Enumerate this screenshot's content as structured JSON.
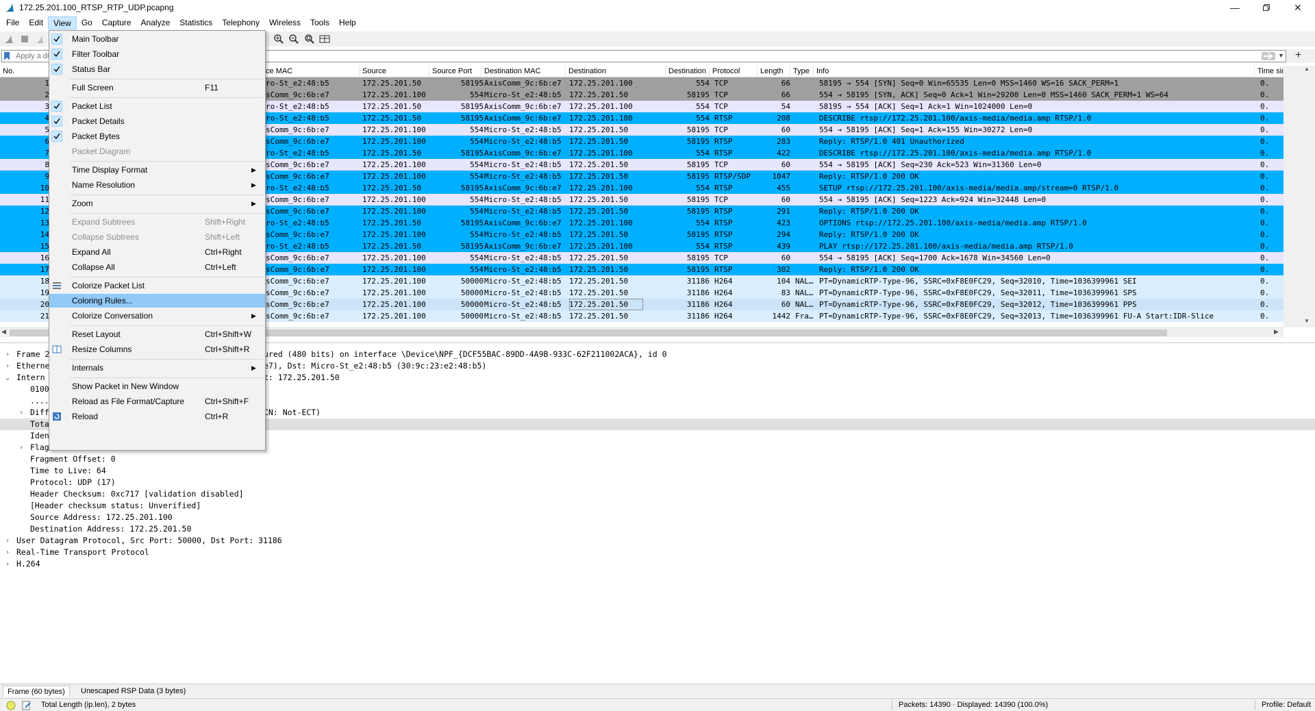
{
  "window": {
    "title": "172.25.201.100_RTSP_RTP_UDP.pcapng",
    "controls": [
      "minimize-icon",
      "restore-icon",
      "close-icon"
    ]
  },
  "menubar": [
    "File",
    "Edit",
    "View",
    "Go",
    "Capture",
    "Analyze",
    "Statistics",
    "Telephony",
    "Wireless",
    "Tools",
    "Help"
  ],
  "filter": {
    "placeholder": "Apply a di"
  },
  "columns": [
    "No.",
    "ce MAC",
    "Source",
    "Source Port",
    "Destination MAC",
    "Destination",
    "Destination Port",
    "Protocol",
    "Length",
    "Type",
    "Info",
    "Time sin"
  ],
  "packets": [
    {
      "no": "1",
      "smac": "ro-St_e2:48:b5",
      "src": "172.25.201.50",
      "sport": "58195",
      "dmac": "AxisComm_9c:6b:e7",
      "dst": "172.25.201.100",
      "dport": "554",
      "proto": "TCP",
      "len": "66",
      "type": "",
      "info": "58195 → 554 [SYN] Seq=0 Win=65535 Len=0 MSS=1460 WS=16 SACK_PERM=1",
      "time": "0.",
      "bg": "#a0a0a0",
      "fg": "#000000"
    },
    {
      "no": "2",
      "smac": "sComm_9c:6b:e7",
      "src": "172.25.201.100",
      "sport": "554",
      "dmac": "Micro-St_e2:48:b5",
      "dst": "172.25.201.50",
      "dport": "58195",
      "proto": "TCP",
      "len": "66",
      "type": "",
      "info": "554 → 58195 [SYN, ACK] Seq=0 Ack=1 Win=29200 Len=0 MSS=1460 SACK_PERM=1 WS=64",
      "time": "0.",
      "bg": "#a0a0a0",
      "fg": "#000000"
    },
    {
      "no": "3",
      "smac": "ro-St_e2:48:b5",
      "src": "172.25.201.50",
      "sport": "58195",
      "dmac": "AxisComm_9c:6b:e7",
      "dst": "172.25.201.100",
      "dport": "554",
      "proto": "TCP",
      "len": "54",
      "type": "",
      "info": "58195 → 554 [ACK] Seq=1 Ack=1 Win=1024000 Len=0",
      "time": "0.",
      "bg": "#e7e6ff",
      "fg": "#000000"
    },
    {
      "no": "4",
      "smac": "ro-St_e2:48:b5",
      "src": "172.25.201.50",
      "sport": "58195",
      "dmac": "AxisComm_9c:6b:e7",
      "dst": "172.25.201.100",
      "dport": "554",
      "proto": "RTSP",
      "len": "208",
      "type": "",
      "info": "DESCRIBE rtsp://172.25.201.100/axis-media/media.amp RTSP/1.0",
      "time": "0.",
      "bg": "#00b0ff",
      "fg": "#000000"
    },
    {
      "no": "5",
      "smac": "sComm_9c:6b:e7",
      "src": "172.25.201.100",
      "sport": "554",
      "dmac": "Micro-St_e2:48:b5",
      "dst": "172.25.201.50",
      "dport": "58195",
      "proto": "TCP",
      "len": "60",
      "type": "",
      "info": "554 → 58195 [ACK] Seq=1 Ack=155 Win=30272 Len=0",
      "time": "0.",
      "bg": "#e7e6ff",
      "fg": "#000000"
    },
    {
      "no": "6",
      "smac": "sComm_9c:6b:e7",
      "src": "172.25.201.100",
      "sport": "554",
      "dmac": "Micro-St_e2:48:b5",
      "dst": "172.25.201.50",
      "dport": "58195",
      "proto": "RTSP",
      "len": "283",
      "type": "",
      "info": "Reply: RTSP/1.0 401 Unauthorized",
      "time": "0.",
      "bg": "#00b0ff",
      "fg": "#000000"
    },
    {
      "no": "7",
      "smac": "ro-St_e2:48:b5",
      "src": "172.25.201.50",
      "sport": "58195",
      "dmac": "AxisComm_9c:6b:e7",
      "dst": "172.25.201.100",
      "dport": "554",
      "proto": "RTSP",
      "len": "422",
      "type": "",
      "info": "DESCRIBE rtsp://172.25.201.100/axis-media/media.amp RTSP/1.0",
      "time": "0.",
      "bg": "#00b0ff",
      "fg": "#000000"
    },
    {
      "no": "8",
      "smac": "sComm_9c:6b:e7",
      "src": "172.25.201.100",
      "sport": "554",
      "dmac": "Micro-St_e2:48:b5",
      "dst": "172.25.201.50",
      "dport": "58195",
      "proto": "TCP",
      "len": "60",
      "type": "",
      "info": "554 → 58195 [ACK] Seq=230 Ack=523 Win=31360 Len=0",
      "time": "0.",
      "bg": "#e7e6ff",
      "fg": "#000000"
    },
    {
      "no": "9",
      "smac": "sComm_9c:6b:e7",
      "src": "172.25.201.100",
      "sport": "554",
      "dmac": "Micro-St_e2:48:b5",
      "dst": "172.25.201.50",
      "dport": "58195",
      "proto": "RTSP/SDP",
      "len": "1047",
      "type": "",
      "info": "Reply: RTSP/1.0 200 OK",
      "time": "0.",
      "bg": "#00b0ff",
      "fg": "#000000"
    },
    {
      "no": "10",
      "smac": "ro-St_e2:48:b5",
      "src": "172.25.201.50",
      "sport": "58195",
      "dmac": "AxisComm_9c:6b:e7",
      "dst": "172.25.201.100",
      "dport": "554",
      "proto": "RTSP",
      "len": "455",
      "type": "",
      "info": "SETUP rtsp://172.25.201.100/axis-media/media.amp/stream=0 RTSP/1.0",
      "time": "0.",
      "bg": "#00b0ff",
      "fg": "#000000"
    },
    {
      "no": "11",
      "smac": "sComm_9c:6b:e7",
      "src": "172.25.201.100",
      "sport": "554",
      "dmac": "Micro-St_e2:48:b5",
      "dst": "172.25.201.50",
      "dport": "58195",
      "proto": "TCP",
      "len": "60",
      "type": "",
      "info": "554 → 58195 [ACK] Seq=1223 Ack=924 Win=32448 Len=0",
      "time": "0.",
      "bg": "#e7e6ff",
      "fg": "#000000"
    },
    {
      "no": "12",
      "smac": "sComm_9c:6b:e7",
      "src": "172.25.201.100",
      "sport": "554",
      "dmac": "Micro-St_e2:48:b5",
      "dst": "172.25.201.50",
      "dport": "58195",
      "proto": "RTSP",
      "len": "291",
      "type": "",
      "info": "Reply: RTSP/1.0 200 OK",
      "time": "0.",
      "bg": "#00b0ff",
      "fg": "#000000"
    },
    {
      "no": "13",
      "smac": "ro-St_e2:48:b5",
      "src": "172.25.201.50",
      "sport": "58195",
      "dmac": "AxisComm_9c:6b:e7",
      "dst": "172.25.201.100",
      "dport": "554",
      "proto": "RTSP",
      "len": "423",
      "type": "",
      "info": "OPTIONS rtsp://172.25.201.100/axis-media/media.amp RTSP/1.0",
      "time": "0.",
      "bg": "#00b0ff",
      "fg": "#000000"
    },
    {
      "no": "14",
      "smac": "sComm_9c:6b:e7",
      "src": "172.25.201.100",
      "sport": "554",
      "dmac": "Micro-St_e2:48:b5",
      "dst": "172.25.201.50",
      "dport": "58195",
      "proto": "RTSP",
      "len": "294",
      "type": "",
      "info": "Reply: RTSP/1.0 200 OK",
      "time": "0.",
      "bg": "#00b0ff",
      "fg": "#000000"
    },
    {
      "no": "15",
      "smac": "ro-St_e2:48:b5",
      "src": "172.25.201.50",
      "sport": "58195",
      "dmac": "AxisComm_9c:6b:e7",
      "dst": "172.25.201.100",
      "dport": "554",
      "proto": "RTSP",
      "len": "439",
      "type": "",
      "info": "PLAY rtsp://172.25.201.100/axis-media/media.amp RTSP/1.0",
      "time": "0.",
      "bg": "#00b0ff",
      "fg": "#000000"
    },
    {
      "no": "16",
      "smac": "sComm_9c:6b:e7",
      "src": "172.25.201.100",
      "sport": "554",
      "dmac": "Micro-St_e2:48:b5",
      "dst": "172.25.201.50",
      "dport": "58195",
      "proto": "TCP",
      "len": "60",
      "type": "",
      "info": "554 → 58195 [ACK] Seq=1700 Ack=1678 Win=34560 Len=0",
      "time": "0.",
      "bg": "#e7e6ff",
      "fg": "#000000"
    },
    {
      "no": "17",
      "smac": "sComm_9c:6b:e7",
      "src": "172.25.201.100",
      "sport": "554",
      "dmac": "Micro-St_e2:48:b5",
      "dst": "172.25.201.50",
      "dport": "58195",
      "proto": "RTSP",
      "len": "302",
      "type": "",
      "info": "Reply: RTSP/1.0 200 OK",
      "time": "0.",
      "bg": "#00b0ff",
      "fg": "#000000"
    },
    {
      "no": "18",
      "smac": "sComm_9c:6b:e7",
      "src": "172.25.201.100",
      "sport": "50000",
      "dmac": "Micro-St_e2:48:b5",
      "dst": "172.25.201.50",
      "dport": "31186",
      "proto": "H264",
      "len": "104",
      "type": "NAL…",
      "info": "PT=DynamicRTP-Type-96, SSRC=0xF8E0FC29, Seq=32010, Time=1036399961 SEI",
      "time": "0.",
      "bg": "#daeeff",
      "fg": "#000000"
    },
    {
      "no": "19",
      "smac": "sComm_9c:6b:e7",
      "src": "172.25.201.100",
      "sport": "50000",
      "dmac": "Micro-St_e2:48:b5",
      "dst": "172.25.201.50",
      "dport": "31186",
      "proto": "H264",
      "len": "83",
      "type": "NAL…",
      "info": "PT=DynamicRTP-Type-96, SSRC=0xF8E0FC29, Seq=32011, Time=1036399961 SPS",
      "time": "0.",
      "bg": "#daeeff",
      "fg": "#000000"
    },
    {
      "no": "20",
      "smac": "sComm_9c:6b:e7",
      "src": "172.25.201.100",
      "sport": "50000",
      "dmac": "Micro-St_e2:48:b5",
      "dst": "172.25.201.50",
      "dport": "31186",
      "proto": "H264",
      "len": "60",
      "type": "NAL…",
      "info": "PT=DynamicRTP-Type-96, SSRC=0xF8E0FC29, Seq=32012, Time=1036399961 PPS",
      "time": "0.",
      "bg": "#cce4f7",
      "fg": "#000000",
      "selected": true
    },
    {
      "no": "21",
      "smac": "sComm_9c:6b:e7",
      "src": "172.25.201.100",
      "sport": "50000",
      "dmac": "Micro-St_e2:48:b5",
      "dst": "172.25.201.50",
      "dport": "31186",
      "proto": "H264",
      "len": "1442",
      "type": "Fra…",
      "info": "PT=DynamicRTP-Type-96, SSRC=0xF8E0FC29, Seq=32013, Time=1036399961 FU-A Start:IDR-Slice",
      "time": "0.",
      "bg": "#daeeff",
      "fg": "#000000"
    }
  ],
  "details": [
    {
      "indent": 0,
      "exp": "right",
      "text": "Frame 2",
      "tail": "ured (480 bits) on interface \\Device\\NPF_{DCF55BAC-89DD-4A9B-933C-62F211002ACA}, id 0"
    },
    {
      "indent": 0,
      "exp": "right",
      "text": "Etherne",
      "tail": "e7), Dst: Micro-St_e2:48:b5 (30:9c:23:e2:48:b5)"
    },
    {
      "indent": 0,
      "exp": "down",
      "text": "Intern",
      "tail": "t: 172.25.201.50"
    },
    {
      "indent": 1,
      "exp": "",
      "text": "0100",
      "tail": ""
    },
    {
      "indent": 1,
      "exp": "",
      "text": "....",
      "tail": ""
    },
    {
      "indent": 1,
      "exp": "right",
      "text": "Diff",
      "tail": "CN: Not-ECT)"
    },
    {
      "indent": 1,
      "exp": "",
      "text": "Tota",
      "tail": "",
      "hl": true
    },
    {
      "indent": 1,
      "exp": "",
      "text": "Iden",
      "tail": ""
    },
    {
      "indent": 1,
      "exp": "right",
      "text": "Flag",
      "tail": ""
    },
    {
      "indent": 1,
      "exp": "",
      "text": "Fragment Offset: 0",
      "tail": ""
    },
    {
      "indent": 1,
      "exp": "",
      "text": "Time to Live: 64",
      "tail": ""
    },
    {
      "indent": 1,
      "exp": "",
      "text": "Protocol: UDP (17)",
      "tail": ""
    },
    {
      "indent": 1,
      "exp": "",
      "text": "Header Checksum: 0xc717 [validation disabled]",
      "tail": ""
    },
    {
      "indent": 1,
      "exp": "",
      "text": "[Header checksum status: Unverified]",
      "tail": ""
    },
    {
      "indent": 1,
      "exp": "",
      "text": "Source Address: 172.25.201.100",
      "tail": ""
    },
    {
      "indent": 1,
      "exp": "",
      "text": "Destination Address: 172.25.201.50",
      "tail": ""
    },
    {
      "indent": 0,
      "exp": "right",
      "text": "User Datagram Protocol, Src Port: 50000, Dst Port: 31186",
      "tail": ""
    },
    {
      "indent": 0,
      "exp": "right",
      "text": "Real-Time Transport Protocol",
      "tail": ""
    },
    {
      "indent": 0,
      "exp": "right",
      "text": "H.264",
      "tail": ""
    }
  ],
  "bytetabs": [
    "Frame (60 bytes)",
    "Unescaped RSP Data (3 bytes)"
  ],
  "status": {
    "field": "Total Length (ip.len), 2 bytes",
    "packets": "Packets: 14390 · Displayed: 14390 (100.0%)",
    "profile": "Profile: Default"
  },
  "viewmenu": [
    {
      "label": "Main Toolbar",
      "checked": true
    },
    {
      "label": "Filter Toolbar",
      "checked": true
    },
    {
      "label": "Status Bar",
      "checked": true
    },
    {
      "sep": true
    },
    {
      "label": "Full Screen",
      "shortcut": "F11"
    },
    {
      "sep": true
    },
    {
      "label": "Packet List",
      "checked": true
    },
    {
      "label": "Packet Details",
      "checked": true
    },
    {
      "label": "Packet Bytes",
      "checked": true
    },
    {
      "label": "Packet Diagram",
      "disabled": true
    },
    {
      "sep": true
    },
    {
      "label": "Time Display Format",
      "submenu": true
    },
    {
      "label": "Name Resolution",
      "submenu": true
    },
    {
      "sep": true
    },
    {
      "label": "Zoom",
      "submenu": true
    },
    {
      "sep": true
    },
    {
      "label": "Expand Subtrees",
      "shortcut": "Shift+Right",
      "disabled": true
    },
    {
      "label": "Collapse Subtrees",
      "shortcut": "Shift+Left",
      "disabled": true
    },
    {
      "label": "Expand All",
      "shortcut": "Ctrl+Right"
    },
    {
      "label": "Collapse All",
      "shortcut": "Ctrl+Left"
    },
    {
      "sep": true
    },
    {
      "label": "Colorize Packet List",
      "icon": "colorize-icon"
    },
    {
      "label": "Coloring Rules...",
      "hover": true
    },
    {
      "label": "Colorize Conversation",
      "submenu": true
    },
    {
      "sep": true
    },
    {
      "label": "Reset Layout",
      "shortcut": "Ctrl+Shift+W"
    },
    {
      "label": "Resize Columns",
      "shortcut": "Ctrl+Shift+R",
      "icon": "resize-columns-icon"
    },
    {
      "sep": true
    },
    {
      "label": "Internals",
      "submenu": true
    },
    {
      "sep": true
    },
    {
      "label": "Show Packet in New Window"
    },
    {
      "label": "Reload as File Format/Capture",
      "shortcut": "Ctrl+Shift+F"
    },
    {
      "label": "Reload",
      "shortcut": "Ctrl+R",
      "icon": "reload-icon"
    }
  ]
}
